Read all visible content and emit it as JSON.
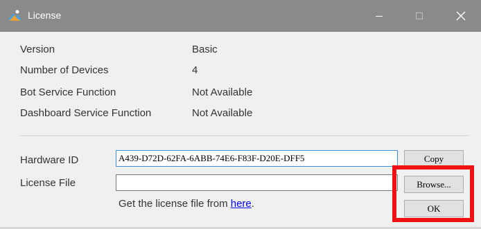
{
  "window": {
    "title": "License",
    "accent_color": "#8a8a8a",
    "controls": {
      "minimize_icon": "minimize-icon",
      "maximize_icon": "maximize-icon",
      "close_icon": "close-icon"
    }
  },
  "info": [
    {
      "label": "Version",
      "value": "Basic"
    },
    {
      "label": "Number of Devices",
      "value": "4"
    },
    {
      "label": "Bot Service Function",
      "value": "Not Available"
    },
    {
      "label": "Dashboard Service Function",
      "value": "Not Available"
    }
  ],
  "hardware": {
    "label": "Hardware ID",
    "value": "A439-D72D-62FA-6ABB-74E6-F83F-D20E-DFF5",
    "copy_label": "Copy"
  },
  "license_file": {
    "label": "License File",
    "value": "",
    "browse_label": "Browse..."
  },
  "hint": {
    "prefix": "Get the license file from ",
    "link_text": "here",
    "suffix": "."
  },
  "ok_label": "OK",
  "highlight_color": "#ee1111"
}
